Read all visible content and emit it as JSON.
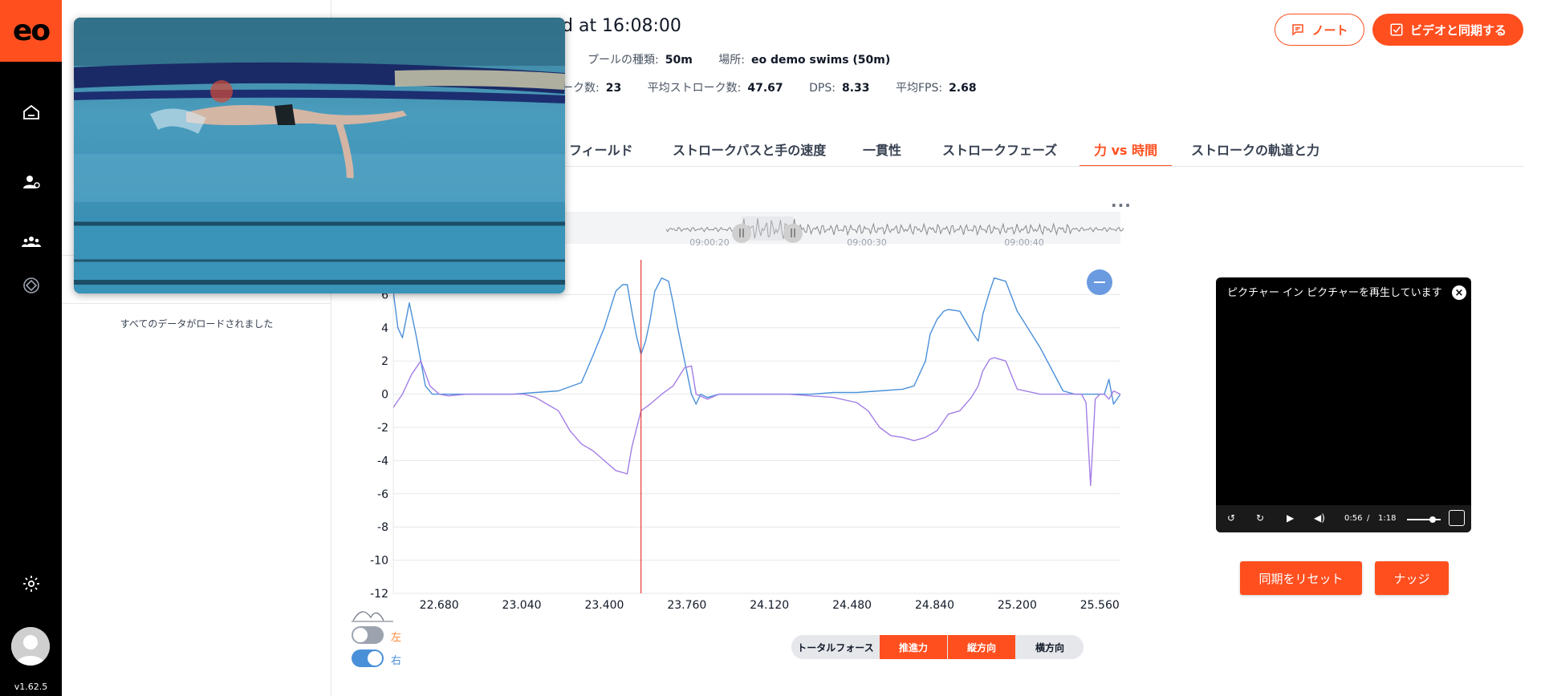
{
  "sidebar": {
    "logo": "eo",
    "version": "v1.62.5",
    "icons": [
      "home-icon",
      "user-settings-icon",
      "team-icon",
      "swim-cycle-icon",
      "gear-icon"
    ]
  },
  "left_panel": {
    "loaded_text": "すべてのデータがロードされました"
  },
  "header": {
    "title": "d at 16:08:00",
    "meta1": [
      {
        "label": "プールの種類:",
        "value": "50m"
      },
      {
        "label": "場所:",
        "value": "eo demo swims (50m)"
      }
    ],
    "meta2": [
      {
        "label": "ーク数:",
        "value": "23"
      },
      {
        "label": "平均ストローク数:",
        "value": "47.67"
      },
      {
        "label": "DPS:",
        "value": "8.33"
      },
      {
        "label": "平均FPS:",
        "value": "2.68"
      }
    ],
    "note_label": "ノート",
    "sync_label": "ビデオと同期する"
  },
  "tabs": [
    {
      "label": "フィールド",
      "active": false
    },
    {
      "label": "ストロークパスと手の速度",
      "active": false
    },
    {
      "label": "一貫性",
      "active": false
    },
    {
      "label": "ストロークフェーズ",
      "active": false
    },
    {
      "label": "力 vs 時間",
      "active": true
    },
    {
      "label": "ストロークの軌道と力",
      "active": false
    }
  ],
  "overview": {
    "tick_labels": [
      "09:00:20",
      "09:00:30",
      "09:00:40"
    ]
  },
  "chart_data": {
    "type": "line",
    "title": "",
    "xlabel": "",
    "ylabel": "",
    "xlim": [
      22.48,
      25.65
    ],
    "ylim": [
      -12,
      8
    ],
    "x_ticks": [
      "22.680",
      "23.040",
      "23.400",
      "23.760",
      "24.120",
      "24.480",
      "24.840",
      "25.200",
      "25.560"
    ],
    "y_ticks": [
      "6",
      "4",
      "2",
      "0",
      "-2",
      "-4",
      "-6",
      "-8",
      "-10",
      "-12"
    ],
    "cursor_x": 23.56,
    "series": [
      {
        "color": "#4a90d9",
        "x": [
          22.48,
          22.5,
          22.52,
          22.55,
          22.58,
          22.62,
          22.65,
          22.7,
          22.8,
          22.9,
          23.0,
          23.1,
          23.2,
          23.3,
          23.35,
          23.4,
          23.45,
          23.48,
          23.5,
          23.52,
          23.54,
          23.56,
          23.58,
          23.6,
          23.62,
          23.65,
          23.68,
          23.7,
          23.72,
          23.75,
          23.78,
          23.8,
          23.82,
          23.85,
          23.9,
          24.0,
          24.1,
          24.2,
          24.3,
          24.4,
          24.5,
          24.6,
          24.7,
          24.75,
          24.8,
          24.82,
          24.85,
          24.88,
          24.9,
          24.95,
          25.0,
          25.03,
          25.05,
          25.08,
          25.1,
          25.15,
          25.2,
          25.3,
          25.4,
          25.45,
          25.48,
          25.5,
          25.52,
          25.55,
          25.58,
          25.6,
          25.62,
          25.65
        ],
        "y": [
          6.2,
          4.0,
          3.4,
          5.5,
          3.5,
          0.5,
          0.0,
          0.0,
          0.0,
          0.0,
          0.0,
          0.1,
          0.2,
          0.7,
          2.3,
          4.0,
          6.2,
          6.6,
          6.6,
          5.0,
          3.5,
          2.4,
          3.2,
          4.5,
          6.2,
          7.0,
          6.8,
          5.5,
          4.0,
          2.0,
          0.0,
          -0.6,
          0.0,
          -0.2,
          0.0,
          0.0,
          0.0,
          0.0,
          0.0,
          0.1,
          0.1,
          0.2,
          0.3,
          0.5,
          2.0,
          3.6,
          4.5,
          5.0,
          5.1,
          5.0,
          3.8,
          3.2,
          4.8,
          6.2,
          7.0,
          6.8,
          5.0,
          2.8,
          0.2,
          0.0,
          0.0,
          0.0,
          0.0,
          0.0,
          0.0,
          0.9,
          -0.6,
          0.0
        ]
      },
      {
        "color": "#a27ee6",
        "x": [
          22.48,
          22.52,
          22.56,
          22.6,
          22.64,
          22.68,
          22.72,
          22.8,
          22.9,
          23.0,
          23.05,
          23.1,
          23.15,
          23.2,
          23.25,
          23.3,
          23.35,
          23.4,
          23.45,
          23.5,
          23.52,
          23.56,
          23.6,
          23.65,
          23.7,
          23.75,
          23.78,
          23.8,
          23.85,
          23.9,
          24.0,
          24.1,
          24.2,
          24.3,
          24.4,
          24.5,
          24.55,
          24.6,
          24.65,
          24.7,
          24.75,
          24.8,
          24.85,
          24.9,
          24.95,
          25.0,
          25.03,
          25.05,
          25.08,
          25.1,
          25.15,
          25.2,
          25.3,
          25.4,
          25.45,
          25.48,
          25.5,
          25.52,
          25.54,
          25.56,
          25.58,
          25.6,
          25.62,
          25.65
        ],
        "y": [
          -0.8,
          0.0,
          1.2,
          2.0,
          0.5,
          0.0,
          -0.1,
          0.0,
          0.0,
          0.0,
          0.0,
          -0.2,
          -0.6,
          -1.0,
          -2.2,
          -3.0,
          -3.4,
          -4.0,
          -4.6,
          -4.8,
          -3.2,
          -1.0,
          -0.6,
          0.0,
          0.5,
          1.6,
          1.7,
          0.0,
          -0.3,
          0.0,
          0.0,
          0.0,
          0.0,
          -0.1,
          -0.2,
          -0.5,
          -1.0,
          -2.0,
          -2.5,
          -2.6,
          -2.8,
          -2.6,
          -2.2,
          -1.2,
          -1.0,
          -0.2,
          0.5,
          1.4,
          2.1,
          2.2,
          2.0,
          0.3,
          0.0,
          0.0,
          0.0,
          0.0,
          -0.5,
          -5.5,
          -0.3,
          0.0,
          0.0,
          -0.3,
          0.2,
          0.0
        ]
      }
    ]
  },
  "toggles": [
    {
      "label": "左",
      "on": false,
      "color": "#ff8a3d"
    },
    {
      "label": "右",
      "on": true,
      "color": "#4a90d9"
    }
  ],
  "force_buttons": {
    "total": "トータルフォース",
    "propulsive": "推進力",
    "vertical": "縦方向",
    "lateral": "横方向"
  },
  "pip": {
    "message": "ピクチャー イン ピクチャーを再生しています",
    "current_time": "0:56",
    "separator": "/",
    "duration": "1:18"
  },
  "actions": {
    "reset_label": "同期をリセット",
    "nudge_label": "ナッジ"
  },
  "colors": {
    "accent": "#ff4f1f"
  }
}
